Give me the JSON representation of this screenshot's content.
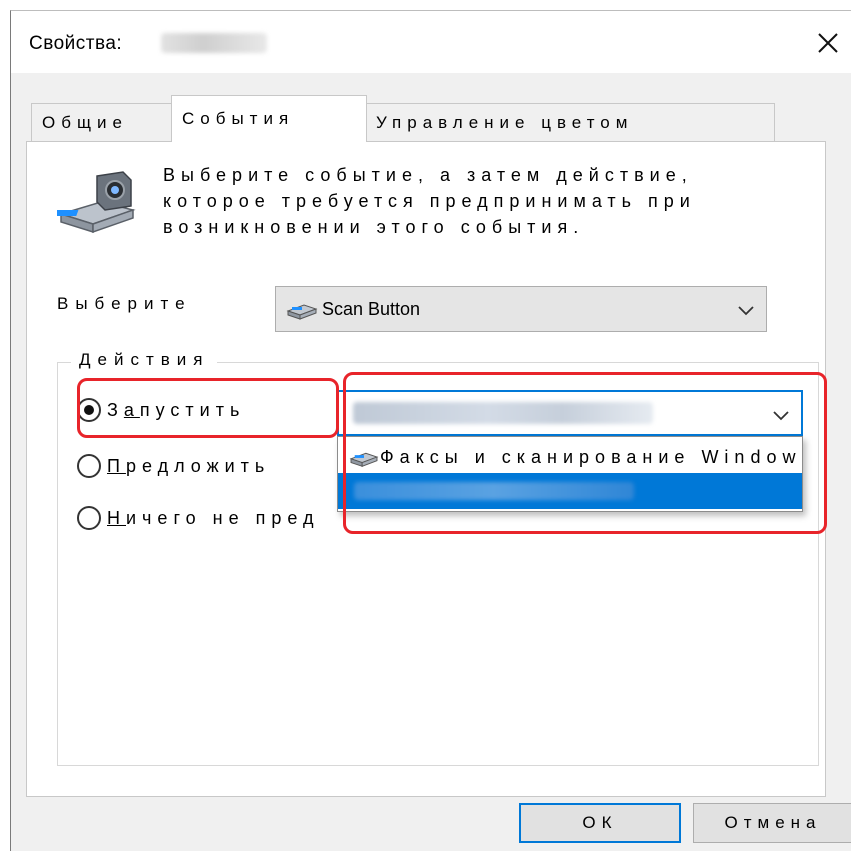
{
  "window": {
    "title": "Свойства:",
    "close_glyph": "✕"
  },
  "tabs": [
    {
      "label": "Общие",
      "active": false
    },
    {
      "label": "События",
      "active": true
    },
    {
      "label": "Управление цветом",
      "active": false
    }
  ],
  "events_tab": {
    "instruction": "Выберите событие, а затем действие, которое требуется предпринимать при возникновении этого события.",
    "select_label": "Выберите",
    "selected_event": "Scan Button",
    "actions_legend": "Действия",
    "radio_launch": {
      "before": "З",
      "accel": "а",
      "after": "пустить",
      "checked": true
    },
    "radio_prompt": {
      "accel": "П",
      "after": "редложить",
      "checked": false
    },
    "radio_nothing": {
      "accel": "Н",
      "after": "ичего не пред",
      "checked": false
    },
    "dropdown_items": [
      {
        "label": "Факсы и сканирование Windows",
        "icon": "scanner-icon",
        "selected": false
      }
    ]
  },
  "buttons": {
    "ok": "ОК",
    "cancel": "Отмена"
  },
  "colors": {
    "accent": "#0078d7",
    "highlight": "#e8242a",
    "window_bg": "#f0f0f0"
  }
}
